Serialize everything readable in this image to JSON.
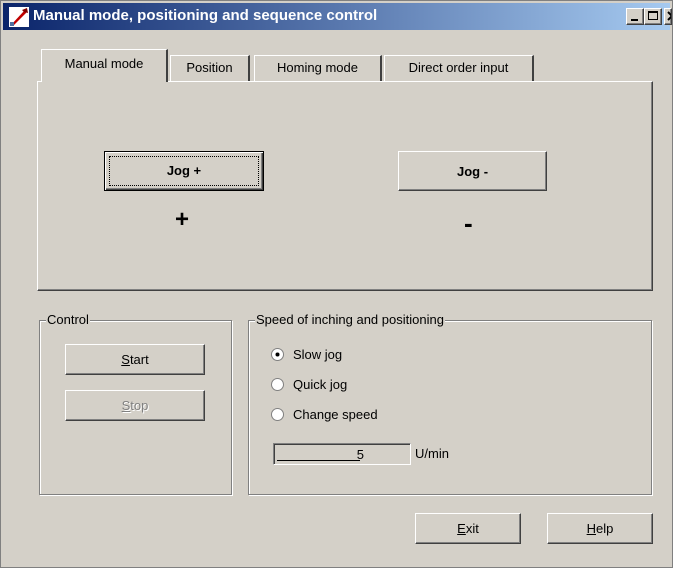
{
  "window": {
    "title": "Manual mode, positioning and sequence control",
    "icon": "app-wrench-icon",
    "controls": [
      "minimize-icon",
      "maximize-icon",
      "close-icon"
    ]
  },
  "tabs": [
    {
      "label": "Manual mode",
      "active": true
    },
    {
      "label": "Position",
      "active": false
    },
    {
      "label": "Homing mode",
      "active": false
    },
    {
      "label": "Direct order input",
      "active": false
    }
  ],
  "manual": {
    "jog_plus_label": "Jog +",
    "jog_minus_label": "Jog -",
    "plus_sign": "+",
    "minus_sign": "-"
  },
  "control_group": {
    "title": "Control",
    "start_accel": "S",
    "start_rest": "tart",
    "stop_accel": "S",
    "stop_rest": "top",
    "stop_enabled": false
  },
  "speed_group": {
    "title": "Speed of inching and positioning",
    "options": [
      {
        "label": "Slow jog",
        "selected": true
      },
      {
        "label": "Quick jog",
        "selected": false
      },
      {
        "label": "Change speed",
        "selected": false
      }
    ],
    "speed_value": "5",
    "speed_unit": "U/min"
  },
  "footer": {
    "exit_accel": "E",
    "exit_rest": "xit",
    "help_accel": "H",
    "help_rest": "elp"
  },
  "colors": {
    "face": "#d4d0c8",
    "title_start": "#0a246a",
    "title_end": "#a6caf0"
  }
}
